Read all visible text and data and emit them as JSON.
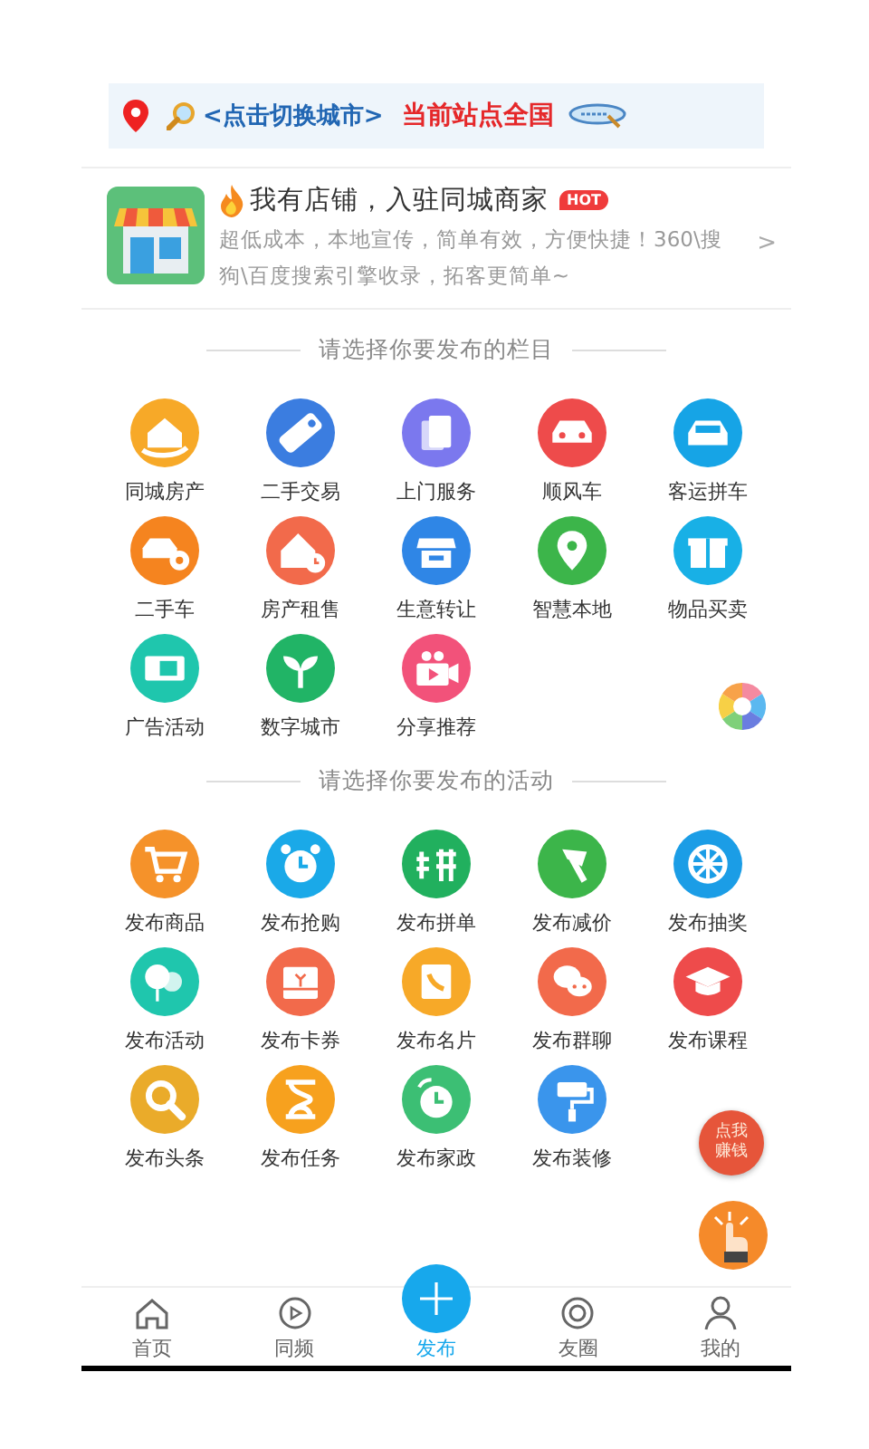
{
  "city_bar": {
    "switch_link": "<点击切换城市>",
    "current_site": "当前站点全国"
  },
  "merchant_card": {
    "title": "我有店铺，入驻同城商家",
    "badge": "HOT",
    "description": "超低成本，本地宣传，简单有效，方便快捷！360\\搜狗\\百度搜索引擎收录，拓客更简单~",
    "chevron": ">"
  },
  "sections": [
    {
      "title": "请选择你要发布的栏目",
      "items": [
        {
          "label": "同城房产",
          "color": "#f7a928"
        },
        {
          "label": "二手交易",
          "color": "#3b7de0"
        },
        {
          "label": "上门服务",
          "color": "#7b78ee"
        },
        {
          "label": "顺风车",
          "color": "#ee4b4b"
        },
        {
          "label": "客运拼车",
          "color": "#16a4e6"
        },
        {
          "label": "二手车",
          "color": "#f5841f"
        },
        {
          "label": "房产租售",
          "color": "#f26a4b"
        },
        {
          "label": "生意转让",
          "color": "#2f86e6"
        },
        {
          "label": "智慧本地",
          "color": "#3cb54a"
        },
        {
          "label": "物品买卖",
          "color": "#18b0e6"
        },
        {
          "label": "广告活动",
          "color": "#1fc6ad"
        },
        {
          "label": "数字城市",
          "color": "#21b466"
        },
        {
          "label": "分享推荐",
          "color": "#f2527a"
        }
      ]
    },
    {
      "title": "请选择你要发布的活动",
      "items": [
        {
          "label": "发布商品",
          "color": "#f5922a"
        },
        {
          "label": "发布抢购",
          "color": "#1aa9e8"
        },
        {
          "label": "发布拼单",
          "color": "#21b05e"
        },
        {
          "label": "发布减价",
          "color": "#3cb54a"
        },
        {
          "label": "发布抽奖",
          "color": "#1b9de6"
        },
        {
          "label": "发布活动",
          "color": "#1fc6ad"
        },
        {
          "label": "发布卡券",
          "color": "#f26a4b"
        },
        {
          "label": "发布名片",
          "color": "#f7a928"
        },
        {
          "label": "发布群聊",
          "color": "#f26a4b"
        },
        {
          "label": "发布课程",
          "color": "#ee4b4b"
        },
        {
          "label": "发布头条",
          "color": "#eaab2a"
        },
        {
          "label": "发布任务",
          "color": "#f7a11e"
        },
        {
          "label": "发布家政",
          "color": "#3cbf74"
        },
        {
          "label": "发布装修",
          "color": "#3a95ec"
        }
      ]
    }
  ],
  "float_buttons": {
    "earn": "点我赚钱"
  },
  "tab_bar": [
    {
      "label": "首页",
      "kind": "plain",
      "selected": false
    },
    {
      "label": "同频",
      "kind": "plain",
      "selected": false
    },
    {
      "label": "发布",
      "kind": "raised",
      "selected": true
    },
    {
      "label": "友圈",
      "kind": "plain",
      "selected": false
    },
    {
      "label": "我的",
      "kind": "plain",
      "selected": false
    }
  ]
}
